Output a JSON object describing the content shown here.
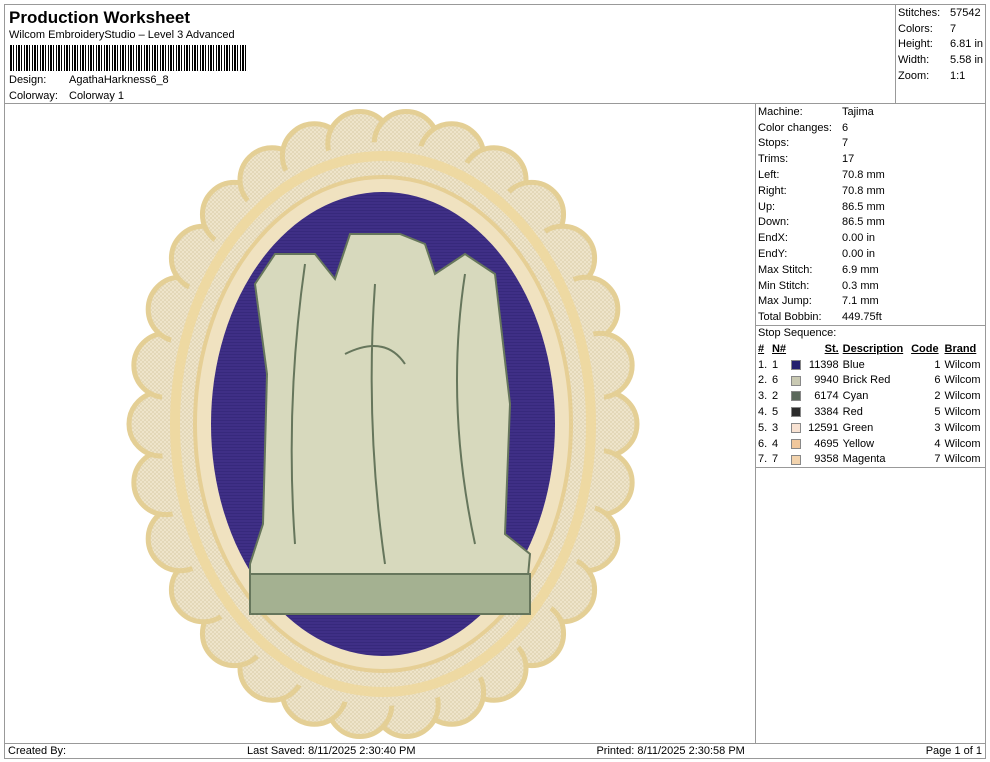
{
  "header": {
    "title": "Production Worksheet",
    "subtitle": "Wilcom EmbroideryStudio – Level 3 Advanced",
    "design_label": "Design:",
    "design": "AgathaHarkness6_8",
    "colorway_label": "Colorway:",
    "colorway": "Colorway 1"
  },
  "stats": [
    {
      "k": "Stitches:",
      "v": "57542"
    },
    {
      "k": "Colors:",
      "v": "7"
    },
    {
      "k": "Height:",
      "v": "6.81 in"
    },
    {
      "k": "Width:",
      "v": "5.58 in"
    },
    {
      "k": "Zoom:",
      "v": "1:1"
    }
  ],
  "machine": [
    {
      "k": "Machine:",
      "v": "Tajima"
    },
    {
      "k": "Color changes:",
      "v": "6"
    },
    {
      "k": "Stops:",
      "v": "7"
    },
    {
      "k": "Trims:",
      "v": "17"
    },
    {
      "k": "Left:",
      "v": "70.8 mm"
    },
    {
      "k": "Right:",
      "v": "70.8 mm"
    },
    {
      "k": "Up:",
      "v": "86.5 mm"
    },
    {
      "k": "Down:",
      "v": "86.5 mm"
    },
    {
      "k": "EndX:",
      "v": "0.00 in"
    },
    {
      "k": "EndY:",
      "v": "0.00 in"
    },
    {
      "k": "Max Stitch:",
      "v": "6.9 mm"
    },
    {
      "k": "Min Stitch:",
      "v": "0.3 mm"
    },
    {
      "k": "Max Jump:",
      "v": "7.1 mm"
    },
    {
      "k": "Total Bobbin:",
      "v": "449.75ft"
    }
  ],
  "stop_sequence": {
    "title": "Stop Sequence:",
    "headers": [
      "#",
      "N#",
      "St.",
      "Description",
      "Code",
      "Brand"
    ],
    "rows": [
      {
        "i": "1.",
        "n": "1",
        "color": "#24206e",
        "st": "11398",
        "desc": "Blue",
        "code": "1",
        "brand": "Wilcom"
      },
      {
        "i": "2.",
        "n": "6",
        "color": "#c9c9b2",
        "st": "9940",
        "desc": "Brick Red",
        "code": "6",
        "brand": "Wilcom"
      },
      {
        "i": "3.",
        "n": "2",
        "color": "#5c695c",
        "st": "6174",
        "desc": "Cyan",
        "code": "2",
        "brand": "Wilcom"
      },
      {
        "i": "4.",
        "n": "5",
        "color": "#2b2b2b",
        "st": "3384",
        "desc": "Red",
        "code": "5",
        "brand": "Wilcom"
      },
      {
        "i": "5.",
        "n": "3",
        "color": "#f8e2d2",
        "st": "12591",
        "desc": "Green",
        "code": "3",
        "brand": "Wilcom"
      },
      {
        "i": "6.",
        "n": "4",
        "color": "#f0c79c",
        "st": "4695",
        "desc": "Yellow",
        "code": "4",
        "brand": "Wilcom"
      },
      {
        "i": "7.",
        "n": "7",
        "color": "#f2d3ad",
        "st": "9358",
        "desc": "Magenta",
        "code": "7",
        "brand": "Wilcom"
      }
    ]
  },
  "footer": {
    "created": "Created By:",
    "saved": "Last Saved: 8/11/2025 2:30:40 PM",
    "printed": "Printed: 8/11/2025 2:30:58 PM",
    "page": "Page 1 of 1"
  }
}
